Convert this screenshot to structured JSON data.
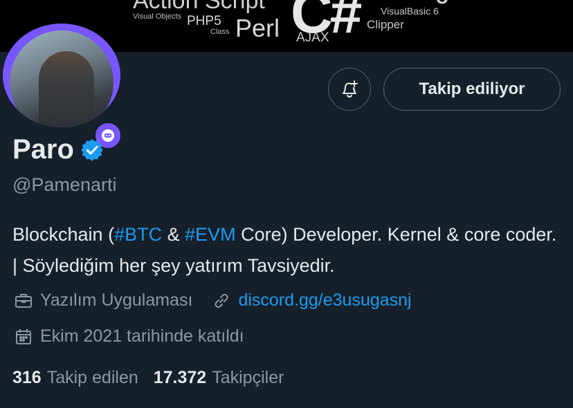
{
  "banner": {
    "words": [
      "Action Script",
      "Visual Objects",
      "PHP5",
      "Class",
      "Perl",
      "C#",
      "AJAX",
      "VisualBasic 6",
      "Clipper",
      "J"
    ]
  },
  "profile": {
    "display_name": "Paro",
    "handle": "@Pamenarti",
    "bio_parts": [
      {
        "text": "Blockchain (",
        "type": "text"
      },
      {
        "text": "#BTC",
        "type": "hashtag"
      },
      {
        "text": " & ",
        "type": "text"
      },
      {
        "text": "#EVM",
        "type": "hashtag"
      },
      {
        "text": " Core) Developer. Kernel & core coder. | Söylediğim her şey yatırım Tavsiyedir.",
        "type": "text"
      }
    ],
    "category": "Yazılım Uygulaması",
    "website": "discord.gg/e3usugasnj",
    "joined": "Ekim 2021 tarihinde katıldı"
  },
  "actions": {
    "notify_icon": "bell-plus-icon",
    "follow_label": "Takip ediliyor"
  },
  "stats": {
    "following_count": "316",
    "following_label": "Takip edilen",
    "followers_count": "17.372",
    "followers_label": "Takipçiler"
  },
  "colors": {
    "background": "#15202b",
    "accent": "#1d9bf0",
    "muted": "#8b98a5",
    "avatar_ring": "#7856ff"
  }
}
